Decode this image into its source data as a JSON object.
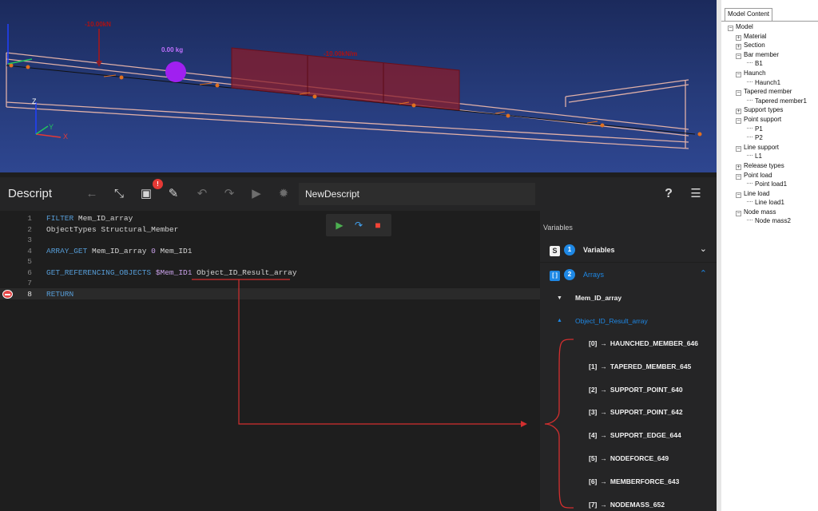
{
  "viewport": {
    "loads": {
      "point_load": "-10.00kN",
      "node_mass": "0.00 kg",
      "line_load": "-10.00kN/m"
    },
    "axes": {
      "z": "Z",
      "y": "Y",
      "x": "X"
    }
  },
  "model_tree": {
    "tab": "Model Content",
    "nodes": [
      {
        "label": "Model",
        "level": 0,
        "box": "−"
      },
      {
        "label": "Material",
        "level": 1,
        "box": "+"
      },
      {
        "label": "Section",
        "level": 1,
        "box": "+"
      },
      {
        "label": "Bar member",
        "level": 1,
        "box": "−"
      },
      {
        "label": "B1",
        "level": 2,
        "box": ""
      },
      {
        "label": "Haunch",
        "level": 1,
        "box": "−"
      },
      {
        "label": "Haunch1",
        "level": 2,
        "box": ""
      },
      {
        "label": "Tapered member",
        "level": 1,
        "box": "−"
      },
      {
        "label": "Tapered member1",
        "level": 2,
        "box": ""
      },
      {
        "label": "Support types",
        "level": 1,
        "box": "+"
      },
      {
        "label": "Point support",
        "level": 1,
        "box": "−"
      },
      {
        "label": "P1",
        "level": 2,
        "box": ""
      },
      {
        "label": "P2",
        "level": 2,
        "box": ""
      },
      {
        "label": "Line support",
        "level": 1,
        "box": "−"
      },
      {
        "label": "L1",
        "level": 2,
        "box": ""
      },
      {
        "label": "Release types",
        "level": 1,
        "box": "+"
      },
      {
        "label": "Point load",
        "level": 1,
        "box": "−"
      },
      {
        "label": "Point load1",
        "level": 2,
        "box": ""
      },
      {
        "label": "Line load",
        "level": 1,
        "box": "−"
      },
      {
        "label": "Line load1",
        "level": 2,
        "box": ""
      },
      {
        "label": "Node mass",
        "level": 1,
        "box": "−"
      },
      {
        "label": "Node mass2",
        "level": 2,
        "box": ""
      }
    ]
  },
  "toolbar": {
    "title": "Descript",
    "badge": "!",
    "script_name": "NewDescript",
    "help": "?",
    "icons": [
      "back-arrow-icon",
      "collapse-icon",
      "save-icon",
      "save-as-icon",
      "undo-icon",
      "redo-icon",
      "play-icon",
      "debug-bug-icon",
      "help-icon",
      "list-icon"
    ]
  },
  "editor": {
    "line_numbers": [
      "1",
      "2",
      "3",
      "4",
      "5",
      "6",
      "7",
      "8"
    ],
    "l1_kw": "FILTER",
    "l1_rest": " Mem_ID_array",
    "l2": "ObjectTypes Structural_Member",
    "l4_kw": "ARRAY_GET",
    "l4_rest": " Mem_ID_array ",
    "l4_num": "0",
    "l4_end": " Mem_ID1",
    "l6_kw": "GET_REFERENCING_OBJECTS",
    "l6_var": " $Mem_ID1",
    "l6_end": " Object_ID_Result_array",
    "l8_kw": "RETURN"
  },
  "variables_panel": {
    "header": "Variables",
    "variables_section": {
      "icon": "S",
      "count": "1",
      "label": "Variables"
    },
    "arrays_section": {
      "icon": "[ ]",
      "count": "2",
      "label": "Arrays"
    },
    "arrays": [
      {
        "name": "Mem_ID_array"
      },
      {
        "name": "Object_ID_Result_array"
      }
    ],
    "result_items": [
      {
        "index": "[0]",
        "value": "HAUNCHED_MEMBER_646"
      },
      {
        "index": "[1]",
        "value": "TAPERED_MEMBER_645"
      },
      {
        "index": "[2]",
        "value": "SUPPORT_POINT_640"
      },
      {
        "index": "[3]",
        "value": "SUPPORT_POINT_642"
      },
      {
        "index": "[4]",
        "value": "SUPPORT_EDGE_644"
      },
      {
        "index": "[5]",
        "value": "NODEFORCE_649"
      },
      {
        "index": "[6]",
        "value": "MEMBERFORCE_643"
      },
      {
        "index": "[7]",
        "value": "NODEMASS_652"
      }
    ],
    "arrow_glyph": "→"
  },
  "colors": {
    "accent": "#1e88e5",
    "annotation": "#d32f2f",
    "keyword": "#569cd6",
    "variable": "#c8a0e8"
  }
}
